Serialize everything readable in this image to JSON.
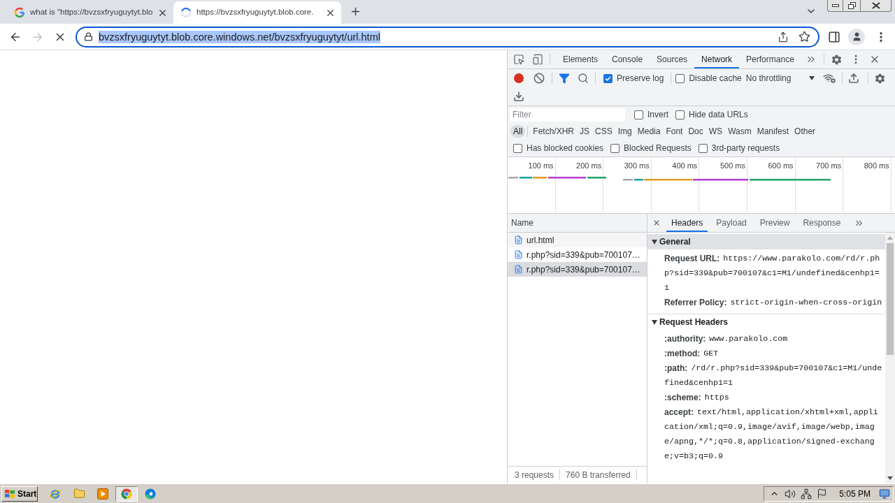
{
  "browser_tabs": [
    {
      "title": "what is \"https://bvzsxfryuguytyt.blo",
      "kind": "search",
      "selected": false
    },
    {
      "title": "https://bvzsxfryuguytyt.blob.core.",
      "kind": "loading",
      "selected": true
    }
  ],
  "toolbar": {
    "loading": true,
    "forward_enabled": false,
    "url": "bvzsxfryuguytyt.blob.core.windows.net/bvzsxfryuguytyt/url.html",
    "url_selected": true
  },
  "devtools": {
    "tabs": [
      {
        "label": "Elements",
        "selected": false
      },
      {
        "label": "Console",
        "selected": false
      },
      {
        "label": "Sources",
        "selected": false
      },
      {
        "label": "Network",
        "selected": true
      },
      {
        "label": "Performance",
        "selected": false
      }
    ],
    "recording": true,
    "preserve_log": {
      "label": "Preserve log",
      "checked": true
    },
    "disable_cache": {
      "label": "Disable cache",
      "checked": false
    },
    "throttling": "No throttling",
    "filter": {
      "placeholder": "Filter"
    },
    "filter_options": [
      {
        "label": "Invert",
        "checked": false
      },
      {
        "label": "Hide data URLs",
        "checked": false
      }
    ],
    "types": [
      {
        "label": "All",
        "selected": true
      },
      {
        "label": "Fetch/XHR",
        "selected": false
      },
      {
        "label": "JS",
        "selected": false
      },
      {
        "label": "CSS",
        "selected": false
      },
      {
        "label": "Img",
        "selected": false
      },
      {
        "label": "Media",
        "selected": false
      },
      {
        "label": "Font",
        "selected": false
      },
      {
        "label": "Doc",
        "selected": false
      },
      {
        "label": "WS",
        "selected": false
      },
      {
        "label": "Wasm",
        "selected": false
      },
      {
        "label": "Manifest",
        "selected": false
      },
      {
        "label": "Other",
        "selected": false
      }
    ],
    "request_flags": [
      {
        "label": "Has blocked cookies",
        "checked": false
      },
      {
        "label": "Blocked Requests",
        "checked": false
      },
      {
        "label": "3rd-party requests",
        "checked": false
      }
    ],
    "timeline_ticks": [
      "100 ms",
      "200 ms",
      "300 ms",
      "400 ms",
      "500 ms",
      "600 ms",
      "700 ms",
      "800 ms"
    ],
    "name_header": "Name",
    "requests": [
      {
        "name": "url.html",
        "selected": false
      },
      {
        "name": "r.php?sid=339&pub=700107…",
        "selected": false
      },
      {
        "name": "r.php?sid=339&pub=700107…",
        "selected": true
      }
    ],
    "summary": [
      "3 requests",
      "760 B transferred"
    ],
    "detail_tabs": [
      {
        "label": "Headers",
        "selected": true
      },
      {
        "label": "Payload",
        "selected": false
      },
      {
        "label": "Preview",
        "selected": false
      },
      {
        "label": "Response",
        "selected": false
      }
    ],
    "sections": [
      {
        "title": "General",
        "selected": true,
        "expanded": true,
        "rows": [
          {
            "name": "Request URL:",
            "value": "https://www.parakolo.com/rd/r.php?sid=339&pub=700107&c1=M1/undefined&cenhp1=1"
          },
          {
            "name": "Referrer Policy:",
            "value": "strict-origin-when-cross-origin"
          }
        ]
      },
      {
        "title": "Request Headers",
        "selected": false,
        "expanded": true,
        "rows": [
          {
            "name": ":authority:",
            "value": "www.parakolo.com"
          },
          {
            "name": ":method:",
            "value": "GET"
          },
          {
            "name": ":path:",
            "value": "/rd/r.php?sid=339&pub=700107&c1=M1/undefined&cenhp1=1"
          },
          {
            "name": ":scheme:",
            "value": "https"
          },
          {
            "name": "accept:",
            "value": "text/html,application/xhtml+xml,application/xml;q=0.9,image/avif,image/webp,image/apng,*/*;q=0.8,application/signed-exchange;v=b3;q=0.9"
          }
        ]
      }
    ]
  },
  "taskbar": {
    "start": "Start",
    "apps": [
      {
        "kind": "ie",
        "active": false
      },
      {
        "kind": "folder",
        "active": false
      },
      {
        "kind": "media",
        "active": false
      },
      {
        "kind": "chrome",
        "active": true
      },
      {
        "kind": "edge",
        "active": false
      }
    ],
    "clock": "5:05 PM"
  }
}
